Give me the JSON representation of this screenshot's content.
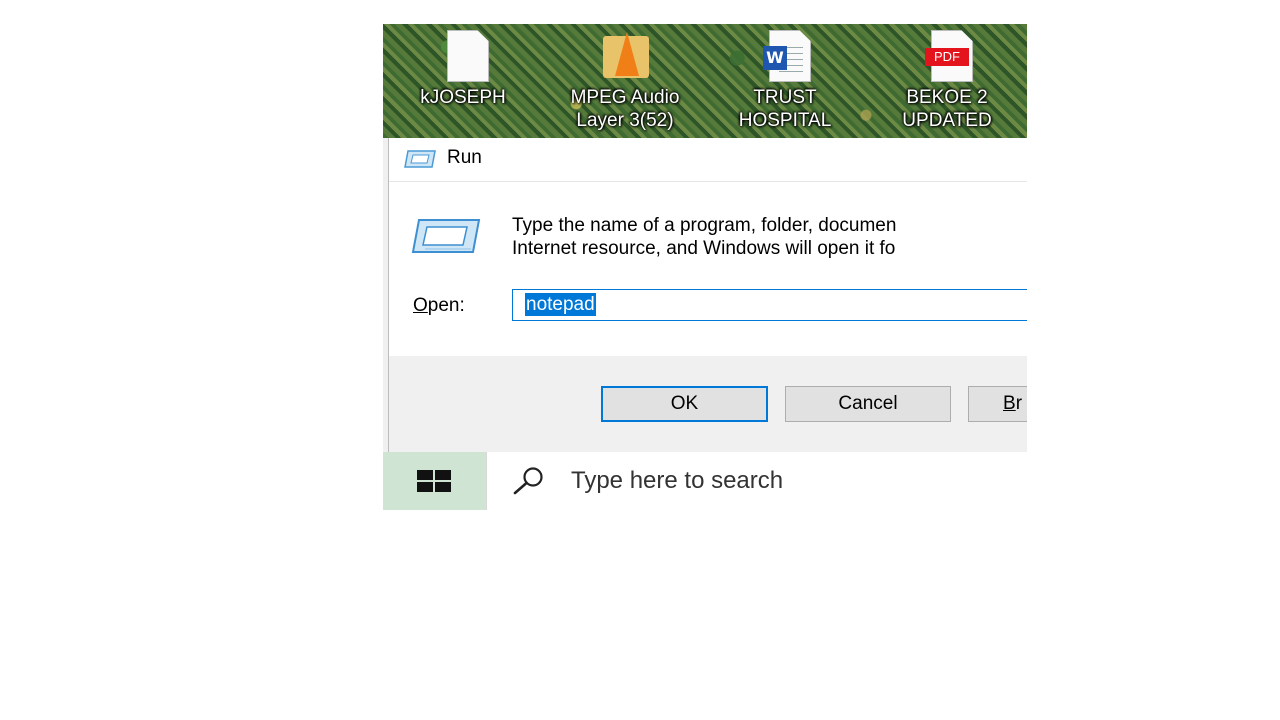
{
  "desktop": {
    "icons": [
      {
        "label_line1": "kJOSEPH",
        "label_line2": "",
        "icon": "text-file-icon"
      },
      {
        "label_line1": "MPEG Audio",
        "label_line2": "Layer 3(52)",
        "icon": "vlc-media-icon"
      },
      {
        "label_line1": "TRUST",
        "label_line2": "HOSPITAL",
        "icon": "word-document-icon"
      },
      {
        "label_line1": "BEKOE 2",
        "label_line2": "UPDATED",
        "icon": "pdf-file-icon"
      }
    ],
    "pdf_badge": "PDF",
    "word_badge": "W"
  },
  "run_dialog": {
    "title": "Run",
    "description_line1": "Type the name of a program, folder, documen",
    "description_line2": "Internet resource, and Windows will open it fo",
    "open_label_first": "O",
    "open_label_rest": "pen:",
    "open_value": "notepad",
    "ok_label": "OK",
    "cancel_label": "Cancel",
    "browse_label_first": "B",
    "browse_label_rest": "r",
    "accent": "#0078d7"
  },
  "taskbar": {
    "search_placeholder": "Type here to search"
  }
}
